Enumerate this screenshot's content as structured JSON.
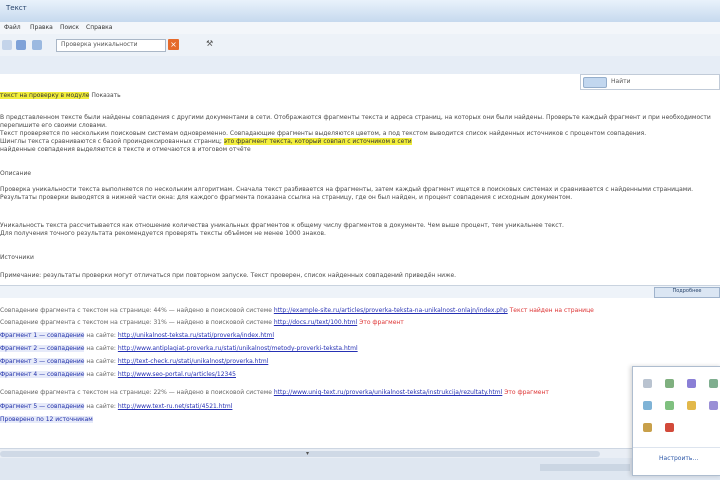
{
  "window": {
    "title": "Текст"
  },
  "menu": [
    "Файл",
    "Правка",
    "Поиск",
    "Справка"
  ],
  "toolbar": {
    "field_text": "Проверка уникальности",
    "close_glyph": "×",
    "tool_glyph": "⚒"
  },
  "search": {
    "label": "Найти"
  },
  "document": {
    "highlight_line": "текст на проверку в модуле",
    "highlight_suffix": "Показать",
    "paragraph1": [
      "В представленном тексте были найдены совпадения с другими документами в сети. Отображаются фрагменты текста и адреса страниц, на которых они были найдены. Проверьте каждый фрагмент и при необходимости перепишите его своими словами.",
      "Текст проверяется по нескольким поисковым системам одновременно. Совпадающие фрагменты выделяются цветом, а под текстом выводится список найденных источников с процентом совпадения.",
      "Шинглы текста сравниваются с базой проиндексированных страниц;",
      "найденные совпадения выделяются в тексте и отмечаются в итоговом отчёте"
    ],
    "paragraph1_highlight": "это фрагмент текста, который совпал с источником в сети",
    "section1": "Описание",
    "paragraph2": [
      "Проверка уникальности текста выполняется по нескольким алгоритмам. Сначала текст разбивается на фрагменты, затем каждый фрагмент ищется в поисковых системах и сравнивается с найденными страницами.",
      "Результаты проверки выводятся в нижней части окна: для каждого фрагмента показана ссылка на страницу, где он был найден, и процент совпадения с исходным документом."
    ],
    "paragraph3": [
      "Уникальность текста рассчитывается как отношение количества уникальных фрагментов к общему числу фрагментов в документе. Чем выше процент, тем уникальнее текст.",
      "Для получения точного результата рекомендуется проверять тексты объёмом не менее 1000 знаков."
    ],
    "section2": "Источники",
    "paragraph4": "Примечание: результаты проверки могут отличаться при повторном запуске. Текст проверен, список найденных совпадений приведён ниже."
  },
  "status": {
    "button": "Подробнее"
  },
  "results": {
    "rows": [
      {
        "label": "",
        "prefix": "Совпадение фрагмента с текстом на странице: 44% — найдено в поисковой системе",
        "url": "http://example-site.ru/articles/proverka-teksta-na-unikalnost-onlajn/index.php",
        "suffix": "Текст найден на странице"
      },
      {
        "label": "",
        "prefix": "Совпадение фрагмента с текстом на странице: 31% — найдено в поисковой системе",
        "url": "http://docs.ru/text/100.html",
        "suffix": "Это фрагмент"
      },
      {
        "label": "Фрагмент 1 — совпадение",
        "prefix": "на сайте:",
        "url": "http://unikalnost-teksta.ru/stati/proverka/index.html",
        "suffix": ""
      },
      {
        "label": "Фрагмент 2 — совпадение",
        "prefix": "на сайте:",
        "url": "http://www.antiplagiat-proverka.ru/stati/unikalnost/metody-proverki-teksta.html",
        "suffix": ""
      },
      {
        "label": "Фрагмент 3 — совпадение",
        "prefix": "на сайте:",
        "url": "http://text-check.ru/stati/unikalnost/proverka.html",
        "suffix": ""
      },
      {
        "label": "Фрагмент 4 — совпадение",
        "prefix": "на сайте:",
        "url": "http://www.seo-portal.ru/articles/12345",
        "suffix": ""
      },
      {
        "label": "",
        "prefix": "Совпадение фрагмента с текстом на странице: 22% — найдено в поисковой системе",
        "url": "http://www.uniq-text.ru/proverka/unikalnost-teksta/instrukcija/rezultaty.html",
        "suffix": "Это фрагмент"
      },
      {
        "label": "Фрагмент 5 — совпадение",
        "prefix": "на сайте:",
        "url": "http://www.text-ru.net/stati/4521.html",
        "suffix": ""
      },
      {
        "label": "Проверено по 12 источникам",
        "prefix": "",
        "url": "",
        "suffix": ""
      }
    ]
  },
  "popup": {
    "link": "Настроить…",
    "colors": [
      "#b9c3d0",
      "#7fb07f",
      "#8a7fd6",
      "#7fae8f",
      "#7fb3d6",
      "#7fc07f",
      "#e2b84a",
      "#9a8fd6",
      "#c8a04a",
      "#d24a3a"
    ]
  }
}
